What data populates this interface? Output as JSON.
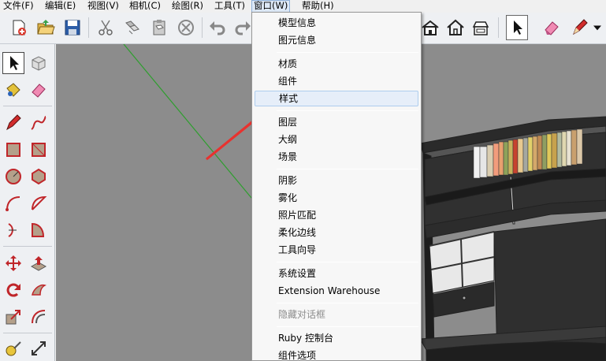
{
  "menubar": {
    "items": [
      {
        "label": "文件(F)"
      },
      {
        "label": "编辑(E)"
      },
      {
        "label": "视图(V)"
      },
      {
        "label": "相机(C)"
      },
      {
        "label": "绘图(R)"
      },
      {
        "label": "工具(T)"
      },
      {
        "label": "窗口(W)"
      },
      {
        "label": "帮助(H)"
      }
    ],
    "open_item": "窗口(W)"
  },
  "window_menu": {
    "items": [
      {
        "label": "模型信息"
      },
      {
        "label": "图元信息"
      },
      {
        "label": "材质"
      },
      {
        "label": "组件"
      },
      {
        "label": "样式",
        "highlighted": true
      },
      {
        "label": "图层"
      },
      {
        "label": "大纲"
      },
      {
        "label": "场景"
      },
      {
        "label": "阴影"
      },
      {
        "label": "雾化"
      },
      {
        "label": "照片匹配"
      },
      {
        "label": "柔化边线"
      },
      {
        "label": "工具向导"
      },
      {
        "label": "系统设置"
      },
      {
        "label": "Extension Warehouse"
      },
      {
        "label": "隐藏对话框",
        "disabled": true
      },
      {
        "label": "Ruby 控制台"
      },
      {
        "label": "组件选项"
      }
    ]
  },
  "toolbar": {
    "icons": [
      "new-file-icon",
      "open-folder-icon",
      "save-icon",
      "cut-icon",
      "copy-icon",
      "paste-icon",
      "erase-circle-icon",
      "undo-icon",
      "redo-icon",
      "house-front-icon",
      "house-outline-icon",
      "house-back-icon",
      "select-arrow-icon",
      "eraser-icon",
      "pencil-icon",
      "dropdown-arrow-icon"
    ]
  },
  "left_tools": {
    "icons": [
      "select-arrow-icon",
      "make-component-icon",
      "paint-bucket-icon",
      "eraser-icon",
      "line-icon",
      "freehand-icon",
      "rectangle-icon",
      "rotated-rectangle-icon",
      "circle-icon",
      "polygon-icon",
      "arc-icon",
      "pie-icon",
      "two-point-arc-icon",
      "three-point-arc-icon",
      "move-icon",
      "push-pull-icon",
      "rotate-icon",
      "follow-me-icon",
      "scale-icon",
      "offset-icon",
      "tape-measure-icon",
      "dimension-icon"
    ]
  },
  "colors": {
    "annotation_arrow": "#e8322f",
    "axis_green": "#2e9e2e",
    "canvas": "#8c8c8c",
    "menu_highlight": "#e6eef9"
  }
}
